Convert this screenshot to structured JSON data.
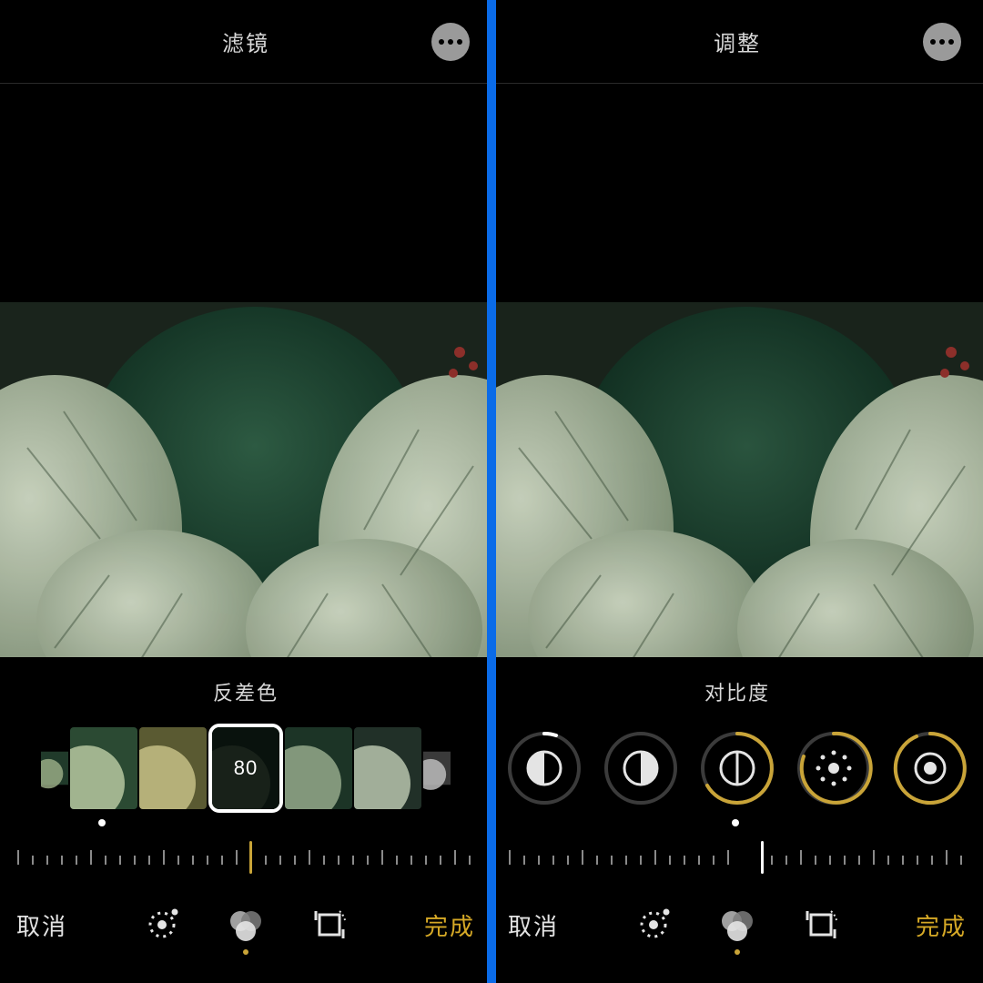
{
  "colors": {
    "accent": "#d6a926",
    "divider": "#0a6be8"
  },
  "left": {
    "header": {
      "title": "滤镜"
    },
    "control": {
      "label": "反差色",
      "selected_value": "80",
      "indicator_pos_pct": 51
    },
    "footer": {
      "cancel": "取消",
      "done": "完成",
      "active_mode": "filters"
    }
  },
  "right": {
    "header": {
      "title": "调整"
    },
    "control": {
      "label": "对比度",
      "dials": [
        {
          "name": "exposure",
          "icon": "half-circle-left",
          "ring_color": "#fff",
          "progress": 0.06
        },
        {
          "name": "highlights",
          "icon": "half-circle-right",
          "ring_color": "#555",
          "progress": 0.0
        },
        {
          "name": "contrast",
          "icon": "contrast-circle",
          "ring_color": "#c9a438",
          "progress": 0.75
        },
        {
          "name": "brightness",
          "icon": "brightness-dots",
          "ring_color": "#c9a438",
          "progress": 0.6
        },
        {
          "name": "black-point",
          "icon": "dot-ring",
          "ring_color": "#c9a438",
          "progress": 0.9
        }
      ],
      "indicator_pos_pct": 55
    },
    "footer": {
      "cancel": "取消",
      "done": "完成",
      "active_mode": "filters"
    }
  }
}
